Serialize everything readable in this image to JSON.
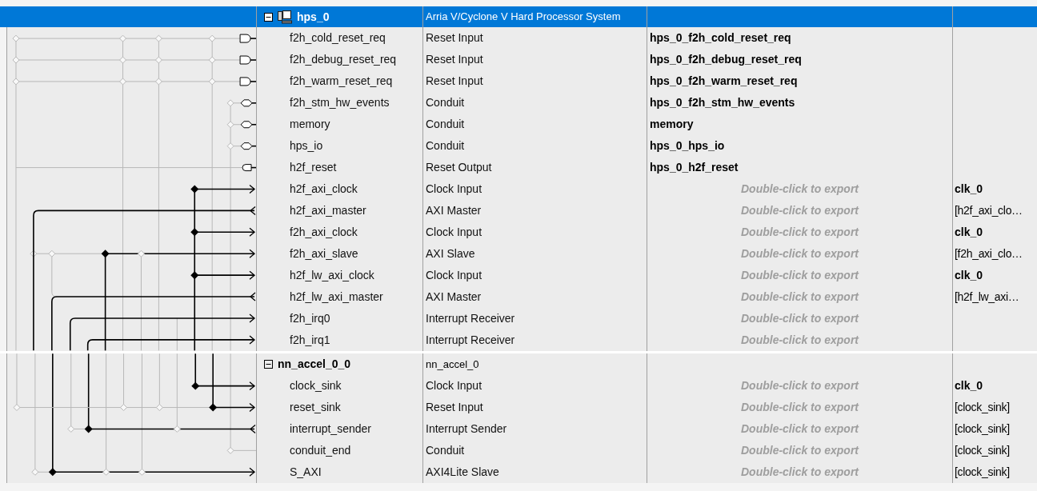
{
  "modules": [
    {
      "name": "hps_0",
      "description": "Arria V/Cyclone V Hard Processor System",
      "kind": "processor",
      "selected": true,
      "expanded": true,
      "ports": [
        {
          "name": "f2h_cold_reset_req",
          "kind": "reset_req",
          "description": "Reset Input",
          "export": "hps_0_f2h_cold_reset_req"
        },
        {
          "name": "f2h_debug_reset_req",
          "kind": "reset_req",
          "description": "Reset Input",
          "export": "hps_0_f2h_debug_reset_req"
        },
        {
          "name": "f2h_warm_reset_req",
          "kind": "reset_req",
          "description": "Reset Input",
          "export": "hps_0_f2h_warm_reset_req"
        },
        {
          "name": "f2h_stm_hw_events",
          "kind": "conduit",
          "description": "Conduit",
          "export": "hps_0_f2h_stm_hw_events"
        },
        {
          "name": "memory",
          "kind": "conduit",
          "description": "Conduit",
          "export": "memory"
        },
        {
          "name": "hps_io",
          "kind": "conduit",
          "description": "Conduit",
          "export": "hps_0_hps_io"
        },
        {
          "name": "h2f_reset",
          "kind": "reset_out",
          "description": "Reset Output",
          "export": "hps_0_h2f_reset"
        },
        {
          "name": "h2f_axi_clock",
          "kind": "sink",
          "description": "Clock Input",
          "export_placeholder": "Double-click to export",
          "clock": {
            "text": "clk_0",
            "explicit": true
          }
        },
        {
          "name": "h2f_axi_master",
          "kind": "source",
          "description": "AXI Master",
          "export_placeholder": "Double-click to export",
          "clock": {
            "text": "[h2f_axi_clo…",
            "explicit": false
          }
        },
        {
          "name": "f2h_axi_clock",
          "kind": "sink",
          "description": "Clock Input",
          "export_placeholder": "Double-click to export",
          "clock": {
            "text": "clk_0",
            "explicit": true
          }
        },
        {
          "name": "f2h_axi_slave",
          "kind": "sink",
          "description": "AXI Slave",
          "export_placeholder": "Double-click to export",
          "clock": {
            "text": "[f2h_axi_clo…",
            "explicit": false
          }
        },
        {
          "name": "h2f_lw_axi_clock",
          "kind": "sink",
          "description": "Clock Input",
          "export_placeholder": "Double-click to export",
          "clock": {
            "text": "clk_0",
            "explicit": true
          }
        },
        {
          "name": "h2f_lw_axi_master",
          "kind": "source",
          "description": "AXI Master",
          "export_placeholder": "Double-click to export",
          "clock": {
            "text": "[h2f_lw_axi…",
            "explicit": false
          }
        },
        {
          "name": "f2h_irq0",
          "kind": "sink",
          "description": "Interrupt Receiver",
          "export_placeholder": "Double-click to export"
        },
        {
          "name": "f2h_irq1",
          "kind": "sink",
          "description": "Interrupt Receiver",
          "export_placeholder": "Double-click to export"
        }
      ]
    },
    {
      "name": "nn_accel_0_0",
      "description": "nn_accel_0",
      "kind": "ip",
      "selected": false,
      "expanded": true,
      "ports": [
        {
          "name": "clock_sink",
          "kind": "sink",
          "description": "Clock Input",
          "export_placeholder": "Double-click to export",
          "clock": {
            "text": "clk_0",
            "explicit": true
          }
        },
        {
          "name": "reset_sink",
          "kind": "sink",
          "description": "Reset Input",
          "export_placeholder": "Double-click to export",
          "clock": {
            "text": "[clock_sink]",
            "explicit": false
          }
        },
        {
          "name": "interrupt_sender",
          "kind": "source",
          "description": "Interrupt Sender",
          "export_placeholder": "Double-click to export",
          "clock": {
            "text": "[clock_sink]",
            "explicit": false
          }
        },
        {
          "name": "conduit_end",
          "kind": "none",
          "description": "Conduit",
          "export_placeholder": "Double-click to export",
          "clock": {
            "text": "[clock_sink]",
            "explicit": false
          }
        },
        {
          "name": "S_AXI",
          "kind": "sink",
          "description": "AXI4Lite Slave",
          "export_placeholder": "Double-click to export",
          "clock": {
            "text": "[clock_sink]",
            "explicit": false
          }
        }
      ]
    }
  ]
}
